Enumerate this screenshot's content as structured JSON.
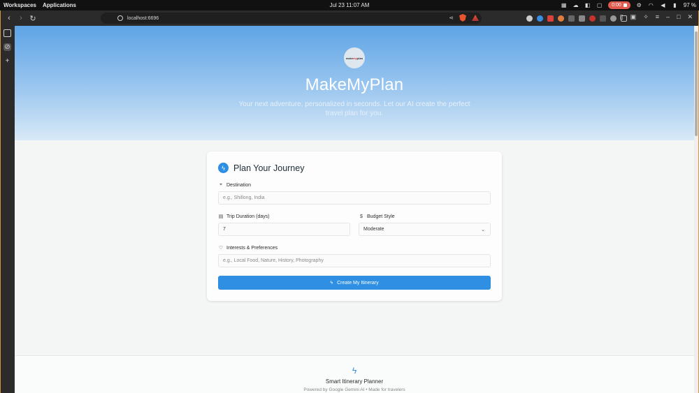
{
  "os": {
    "workspaces": "Workspaces",
    "applications": "Applications",
    "clock": "Jul 23  11:07 AM",
    "recording_time": "0:00",
    "battery": "97 %"
  },
  "browser": {
    "url": "localhost:6696"
  },
  "hero": {
    "logo_text": "make",
    "logo_mark": "my",
    "logo_tail": "plan",
    "title": "MakeMyPlan",
    "subtitle": "Your next adventure, personalized in seconds. Let our AI create the perfect travel plan for you."
  },
  "form": {
    "heading": "Plan Your Journey",
    "destination": {
      "label": "Destination",
      "placeholder": "e.g., Shillong, India",
      "value": ""
    },
    "duration": {
      "label": "Trip Duration (days)",
      "value": "7"
    },
    "budget": {
      "label": "Budget Style",
      "value": "Moderate"
    },
    "interests": {
      "label": "Interests & Preferences",
      "placeholder": "e.g., Local Food, Nature, History, Photography",
      "value": ""
    },
    "submit_label": "Create My Itinerary"
  },
  "footer": {
    "title": "Smart Itinerary Planner",
    "subtitle": "Powered by Google Gemini AI • Made for travelers"
  },
  "icons": {
    "accent": "#2e8fe3",
    "hero_gradient_top": "#5ea4e6",
    "hero_gradient_bottom": "#d8e9f7"
  }
}
